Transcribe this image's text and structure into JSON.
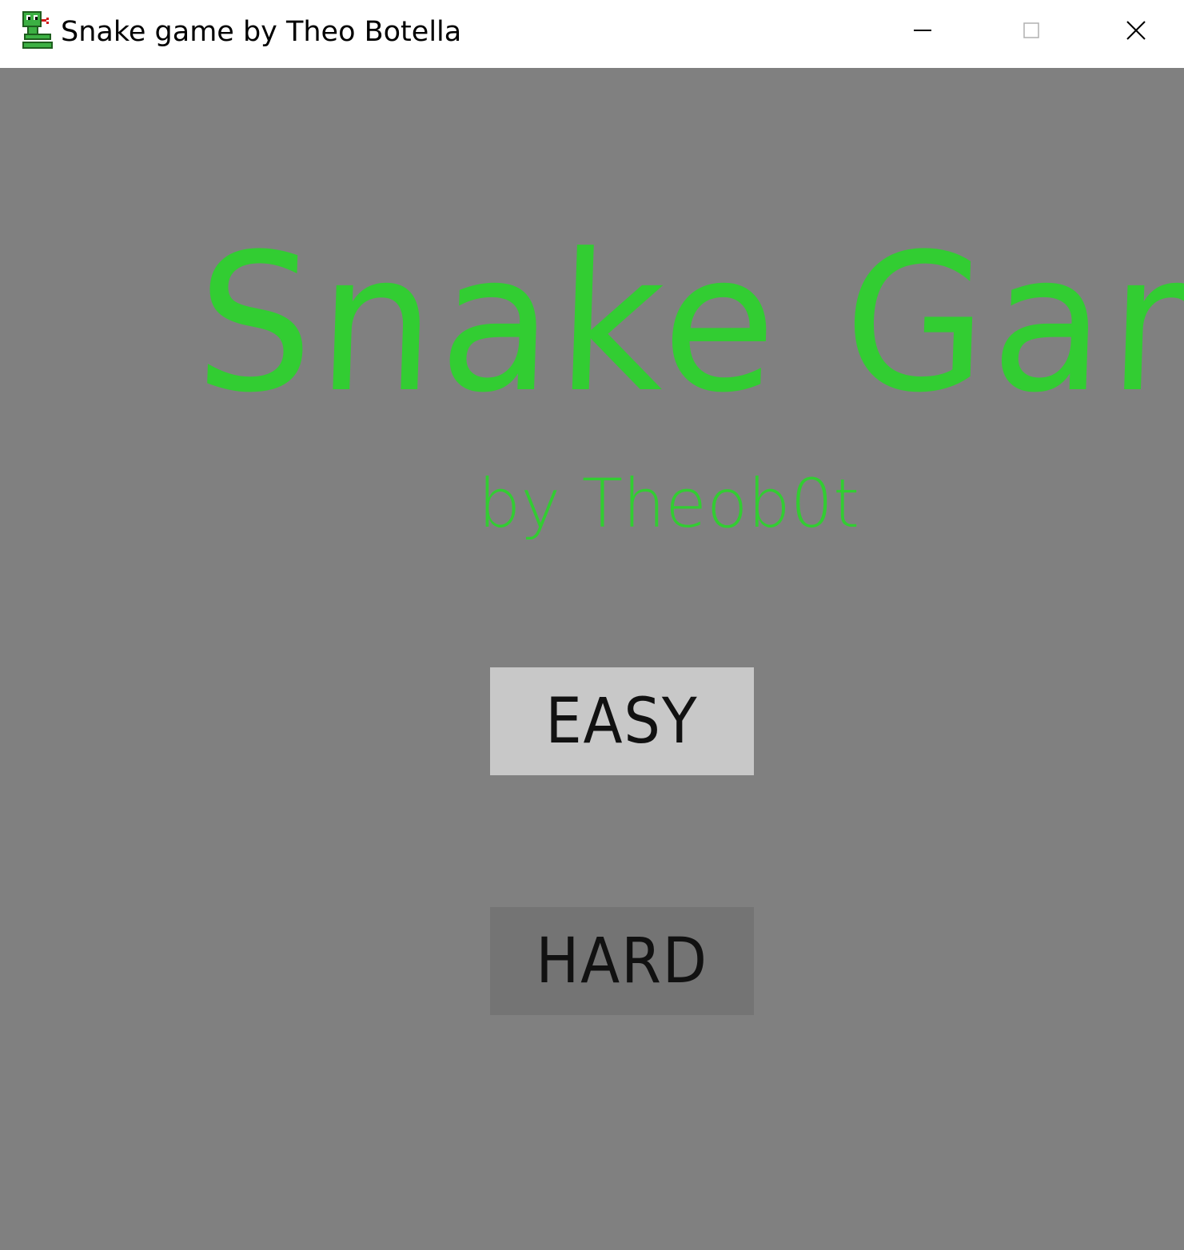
{
  "window": {
    "title": "Snake game by Theo Botella",
    "icon": "snake-icon",
    "controls": {
      "minimize_icon": "minimize-icon",
      "maximize_icon": "maximize-icon",
      "close_icon": "close-icon"
    }
  },
  "game": {
    "title": "Snake Game",
    "subtitle": "by Theob0t",
    "buttons": {
      "easy_label": "EASY",
      "hard_label": "HARD"
    }
  },
  "colors": {
    "background": "#808080",
    "title_green": "#32cd32",
    "easy_button_bg": "#c8c8c8",
    "hard_button_bg": "#747474",
    "button_text": "#111111"
  }
}
